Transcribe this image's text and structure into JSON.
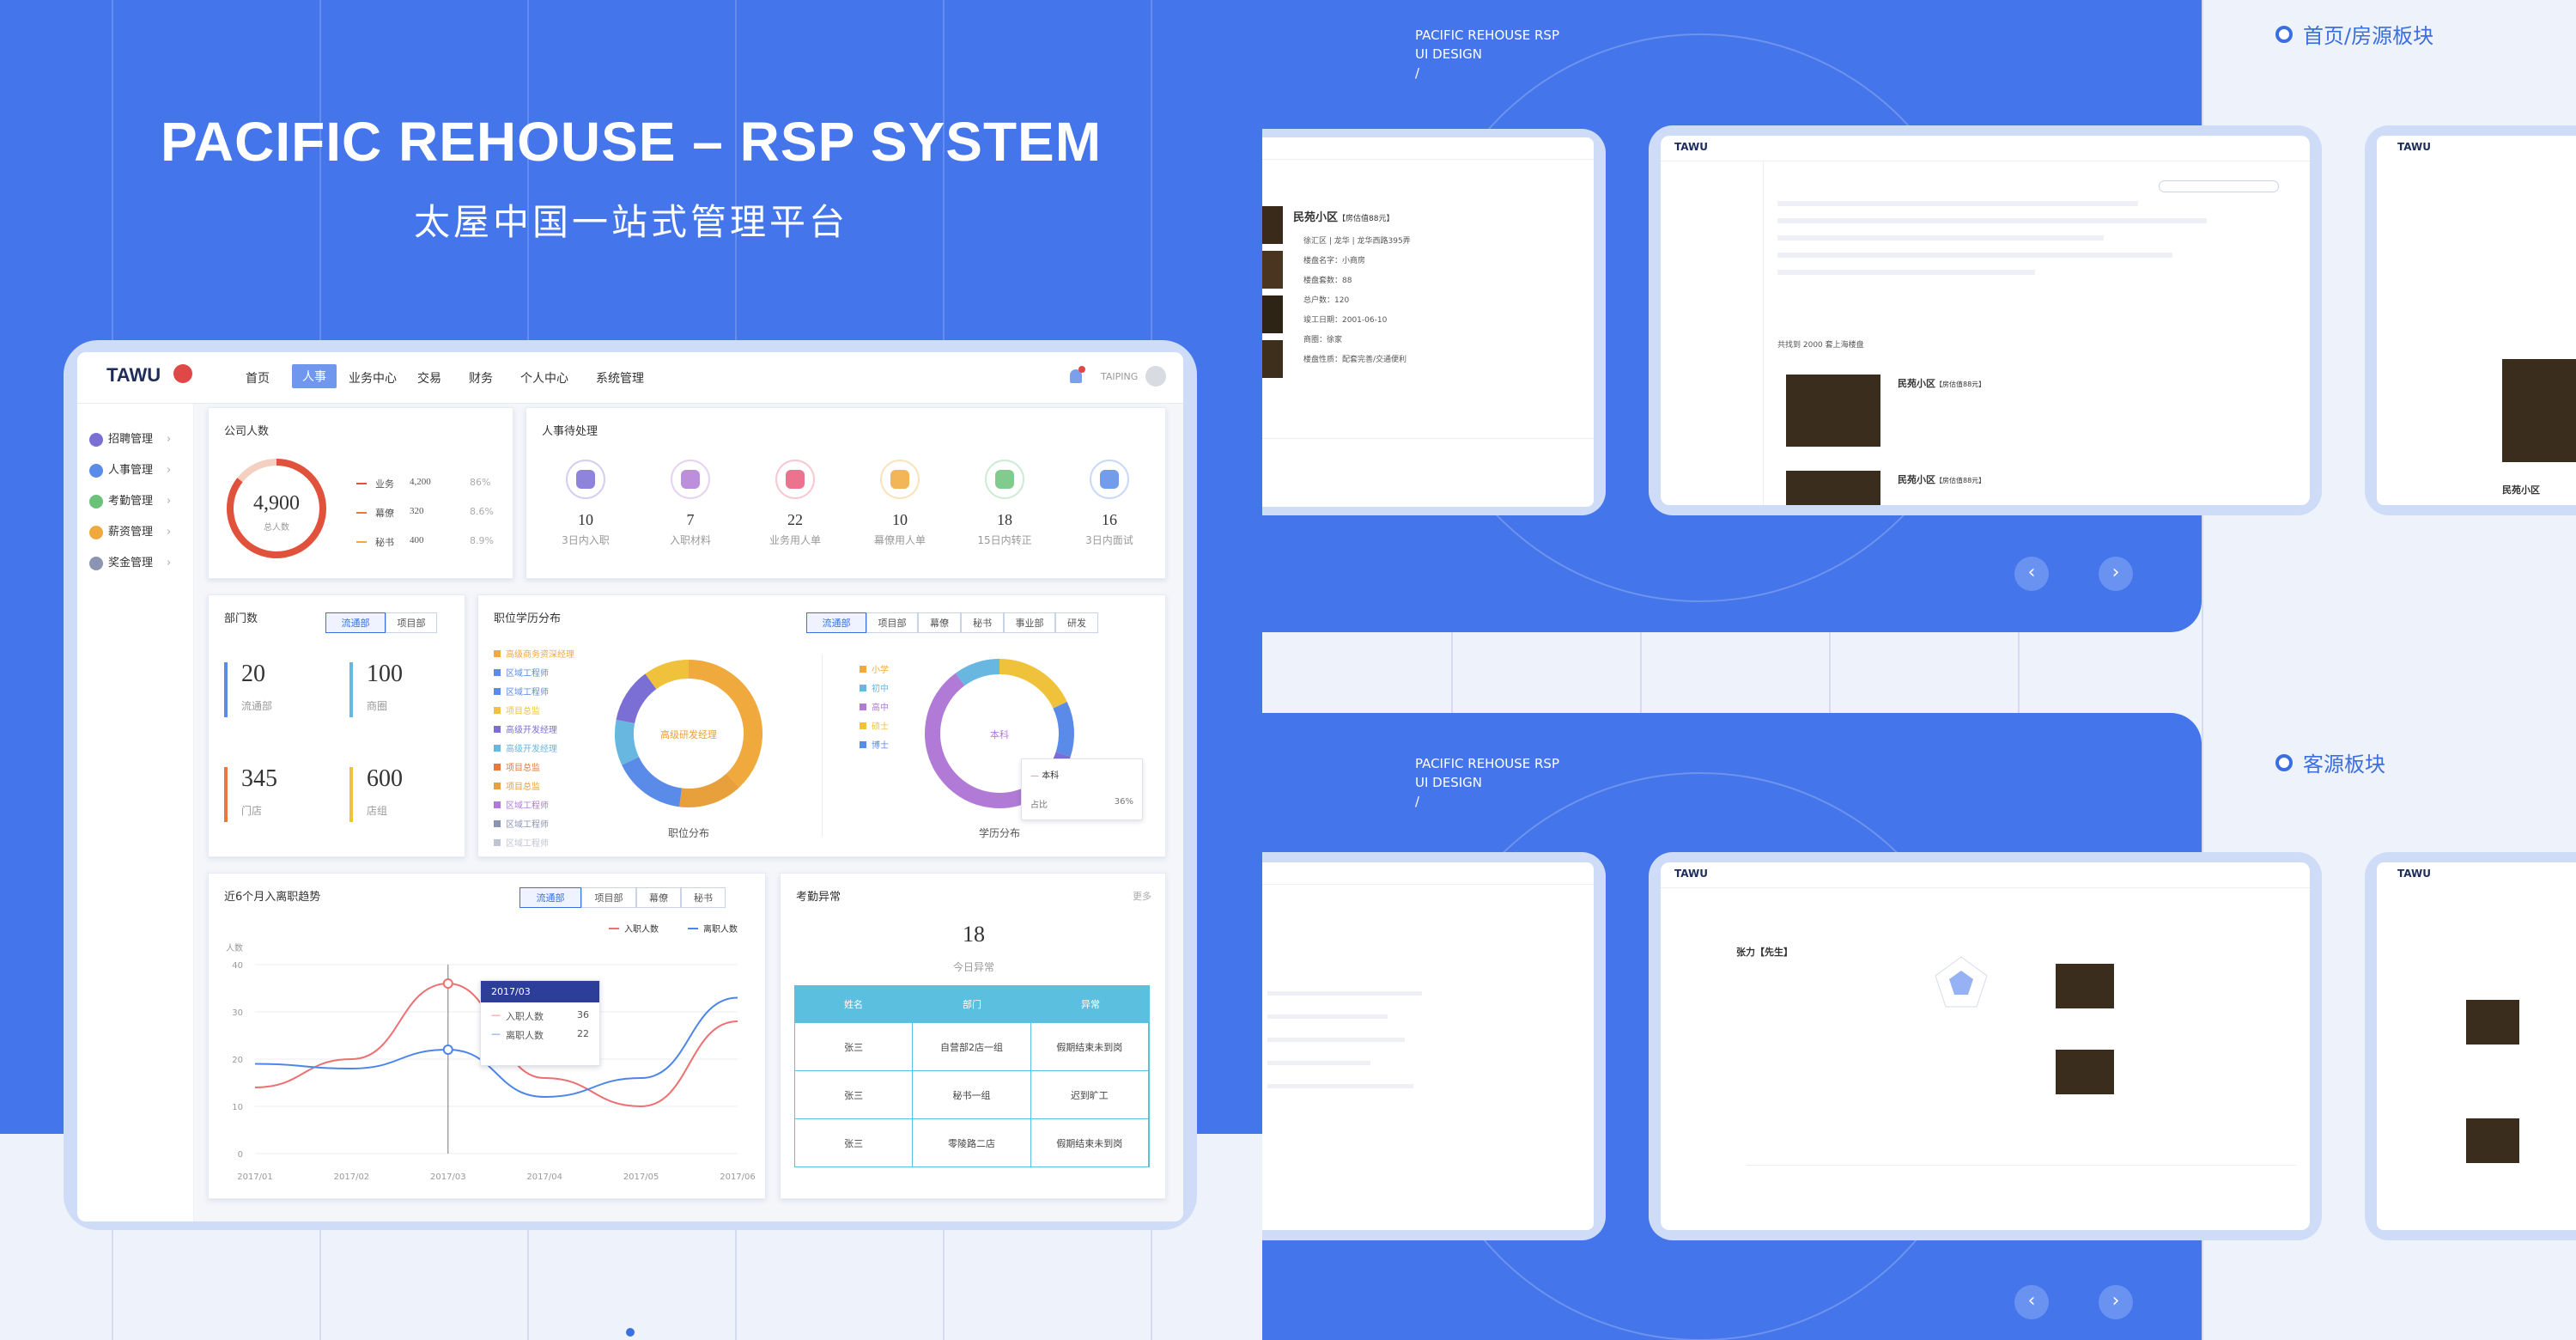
{
  "hero": {
    "title": "PACIFIC REHOUSE – RSP SYSTEM",
    "subtitle": "太屋中国一站式管理平台"
  },
  "dashboard": {
    "logo": "TAWU",
    "nav": [
      "首页",
      "人事",
      "业务中心",
      "交易",
      "财务",
      "个人中心",
      "系统管理"
    ],
    "user": "TAIPING",
    "sidebar": [
      "招聘管理",
      "人事管理",
      "考勤管理",
      "薪资管理",
      "奖金管理"
    ],
    "sidebar_colors": [
      "#7b6fd6",
      "#5b8be8",
      "#6cc27a",
      "#f0a93c",
      "#8c94b3"
    ],
    "company": {
      "title": "公司人数",
      "total": "4,900",
      "total_label": "总人数",
      "rows": [
        {
          "name": "业务",
          "value": "4,200",
          "pct": "86%"
        },
        {
          "name": "幕僚",
          "value": "320",
          "pct": "8.6%"
        },
        {
          "name": "秘书",
          "value": "400",
          "pct": "8.9%"
        }
      ]
    },
    "pending": {
      "title": "人事待处理",
      "items": [
        {
          "value": "10",
          "label": "3日内入职",
          "color": "#7b6fd6"
        },
        {
          "value": "7",
          "label": "入职材料",
          "color": "#b07ad6"
        },
        {
          "value": "22",
          "label": "业务用人单",
          "color": "#e85a7a"
        },
        {
          "value": "10",
          "label": "幕僚用人单",
          "color": "#f0a93c"
        },
        {
          "value": "18",
          "label": "15日内转正",
          "color": "#6cc27a"
        },
        {
          "value": "16",
          "label": "3日内面试",
          "color": "#5b8be8"
        }
      ]
    },
    "dept": {
      "title": "部门数",
      "tabs": [
        "流通部",
        "项目部"
      ],
      "stats": [
        {
          "value": "20",
          "label": "流通部",
          "color": "#5b8be8"
        },
        {
          "value": "100",
          "label": "商圈",
          "color": "#67b7e0"
        },
        {
          "value": "345",
          "label": "门店",
          "color": "#e8783c"
        },
        {
          "value": "600",
          "label": "店组",
          "color": "#f0c23c"
        }
      ]
    },
    "edu": {
      "title": "职位学历分布",
      "tabs": [
        "流通部",
        "项目部",
        "幕僚",
        "秘书",
        "事业部",
        "研发"
      ],
      "legend1": [
        "高级商务资深经理",
        "区域工程师",
        "区域工程师",
        "项目总监",
        "高级开发经理",
        "高级开发经理",
        "项目总监",
        "项目总监",
        "区域工程师",
        "区域工程师",
        "区域工程师"
      ],
      "legend1_colors": [
        "#f0a93c",
        "#5b8be8",
        "#5b8be8",
        "#f0c23c",
        "#7b6fd6",
        "#67b7e0",
        "#e8783c",
        "#e8a03c",
        "#b07ad6",
        "#8c94b3",
        "#c0c4d0"
      ],
      "donut1_center": "高级研发经理",
      "donut1_caption": "职位分布",
      "legend2": [
        "小学",
        "初中",
        "高中",
        "硕士",
        "博士"
      ],
      "legend2_colors": [
        "#f0a93c",
        "#67b7e0",
        "#b07ad6",
        "#f0c23c",
        "#5b8be8"
      ],
      "donut2_center": "本科",
      "donut2_caption": "学历分布",
      "tooltip": {
        "title": "本科",
        "key": "占比",
        "value": "36%"
      }
    },
    "trend": {
      "title": "近6个月入离职趋势",
      "tabs": [
        "流通部",
        "项目部",
        "幕僚",
        "秘书"
      ],
      "legend": [
        "入职人数",
        "离职人数"
      ],
      "ylabel": "人数",
      "tooltip": {
        "title": "2017/03",
        "rows": [
          {
            "name": "入职人数",
            "value": "36"
          },
          {
            "name": "离职人数",
            "value": "22"
          }
        ]
      }
    },
    "attendance": {
      "title": "考勤异常",
      "more": "更多",
      "count": "18",
      "count_label": "今日异常",
      "headers": [
        "姓名",
        "部门",
        "异常"
      ],
      "rows": [
        [
          "张三",
          "自营部2店一组",
          "假期结束未到岗"
        ],
        [
          "张三",
          "秘书一组",
          "迟到旷工"
        ],
        [
          "张三",
          "零陵路二店",
          "假期结束未到岗"
        ]
      ]
    }
  },
  "chart_data": {
    "type": "line",
    "title": "近6个月入离职趋势",
    "categories": [
      "2017/01",
      "2017/02",
      "2017/03",
      "2017/04",
      "2017/05",
      "2017/06"
    ],
    "ylabel": "人数",
    "ylim": [
      0,
      40
    ],
    "series": [
      {
        "name": "入职人数",
        "values": [
          14,
          20,
          36,
          16,
          10,
          28
        ],
        "color": "#ec7072"
      },
      {
        "name": "离职人数",
        "values": [
          19,
          18,
          22,
          12,
          16,
          33
        ],
        "color": "#4d86e8"
      }
    ]
  },
  "right": {
    "block_label_1": "首页/房源板块",
    "block_label_2": "客源板块",
    "design_tag_1": [
      "PACIFIC REHOUSE RSP",
      "UI DESIGN",
      "/"
    ],
    "design_tag_2": [
      "PACIFIC REHOUSE RSP",
      "UI DESIGN",
      "/"
    ],
    "house_title": "民苑小区",
    "house_badge": "【房估值88元】",
    "house_lines": [
      "徐汇区 | 龙华 | 龙华西路395弄",
      "楼盘名字：小商房",
      "楼盘套数：88",
      "总户数：120",
      "竣工日期：2001-06-10",
      "商圈：徐家",
      "楼盘性质：配套完善/交通便利"
    ],
    "result_text": "共找到 2000 套上海楼盘",
    "customer_name": "张力【先生】",
    "prev": "‹",
    "next": "›"
  }
}
